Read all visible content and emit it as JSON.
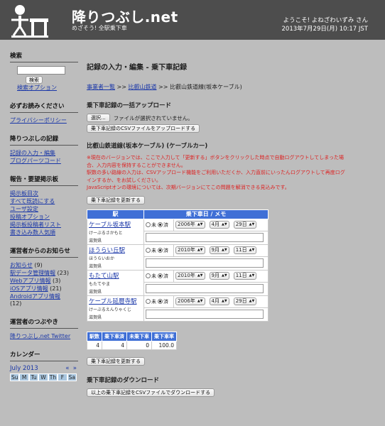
{
  "header": {
    "title": "降りつぶし.net",
    "subtitle": "めざそう! 全駅乗下車",
    "welcome": "ようこそ! よねざわいずみ さん",
    "datetime": "2013年7月29日(月) 10:17 JST"
  },
  "sidebar": {
    "search": {
      "heading": "検索",
      "button": "検索",
      "option_link": "検索オプション"
    },
    "must_read": {
      "heading": "必ずお読みください",
      "links": [
        "プライバシーポリシー"
      ]
    },
    "records": {
      "heading": "降りつぶしの記録",
      "links": [
        "記録の入力・編集",
        "ブログパーツコード"
      ]
    },
    "report": {
      "heading": "報告・要望掲示板",
      "links": [
        "掲示板目次",
        "すべて既読にする",
        "ユーザ設定",
        "投稿オプション",
        "掲示板投稿者リスト",
        "書き込み数人気順"
      ]
    },
    "news": {
      "heading": "運営者からのお知らせ",
      "items": [
        {
          "label": "お知らせ",
          "count": "(9)"
        },
        {
          "label": "駅データ管理情報",
          "count": "(23)"
        },
        {
          "label": "Webアプリ情報",
          "count": "(3)"
        },
        {
          "label": "iOSアプリ情報",
          "count": "(21)"
        },
        {
          "label": "Androidアプリ情報",
          "count": "(12)"
        }
      ]
    },
    "tweets": {
      "heading": "運営者のつぶやき",
      "link": "降りつぶし.net Twitter"
    },
    "calendar": {
      "heading": "カレンダー",
      "month": "July 2013",
      "prev": "«",
      "next": "»",
      "days": [
        "Su",
        "M",
        "Tu",
        "W",
        "Th",
        "F",
        "Sa"
      ]
    }
  },
  "main": {
    "title": "記録の入力・編集 - 乗下車記録",
    "breadcrumb": [
      "事業者一覧",
      "比叡山鉄道",
      "比叡山鉄道線(坂本ケーブル)"
    ],
    "breadcrumb_sep": ">>",
    "bulk_upload": {
      "heading": "乗下車記録の一括アップロード",
      "choose_button": "選択...",
      "no_file": "ファイルが選択されていません。",
      "upload_button": "乗下車記録のCSVファイルをアップロードする"
    },
    "line_heading": "比叡山鉄道線(坂本ケーブル) (ケーブルカー)",
    "notice": [
      "※現在のバージョンでは、ここで入力して「更新する」ボタンをクリックした時点で自動ログアウトしてしまった場",
      "合、入力内容を保持することができません。",
      "駅数の多い路線の入力は、CSVアップロード機能をご利用いただくか、入力直前にいったんログアウトして再度ログ",
      "インするか、をお試しください。",
      "JavaScriptオンの環境については、次期バージョンにてこの問題を解消できる見込みです。"
    ],
    "update_button": "乗下車記録を更新する",
    "table": {
      "col_station": "駅",
      "col_date": "乗下車日 / メモ",
      "radio_no": "未",
      "radio_yes": "済",
      "rows": [
        {
          "name": "ケーブル坂本駅",
          "kana": "けーぶるさかもと",
          "pref": "滋賀県",
          "year": "2006年",
          "month": "4月",
          "day": "29日"
        },
        {
          "name": "ほうらい丘駅",
          "kana": "ほうらいおか",
          "pref": "滋賀県",
          "year": "2010年",
          "month": "9月",
          "day": "11日"
        },
        {
          "name": "もたて山駅",
          "kana": "もたてやま",
          "pref": "滋賀県",
          "year": "2010年",
          "month": "9月",
          "day": "11日"
        },
        {
          "name": "ケーブル延暦寺駅",
          "kana": "けーぶるえんりゃくじ",
          "pref": "滋賀県",
          "year": "2006年",
          "month": "4月",
          "day": "29日"
        }
      ]
    },
    "summary": {
      "headers": [
        "駅数",
        "乗下車済",
        "未乗下車",
        "乗下車率"
      ],
      "values": [
        "4",
        "4",
        "0",
        "100.0"
      ]
    },
    "download": {
      "heading": "乗下車記録のダウンロード",
      "button": "以上の乗下車記録をCSVファイルでダウンロードする"
    }
  }
}
